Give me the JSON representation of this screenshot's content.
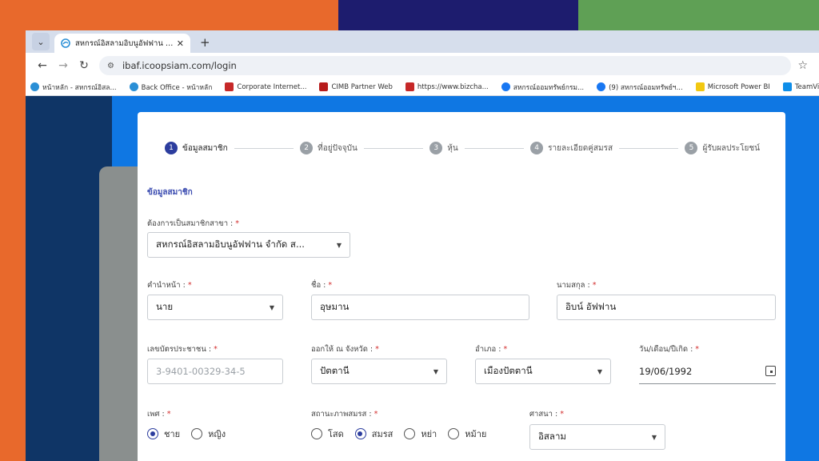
{
  "browser": {
    "tab_title": "สหกรณ์อิสลามอิบนูอัฟฟาน จำกัด",
    "url": "ibaf.icoopsiam.com/login",
    "bookmarks": [
      {
        "label": "หน้าหลัก - สหกรณ์อิสล...",
        "icon": "coop-logo",
        "color": "#2a8fd6"
      },
      {
        "label": "Back Office - หน้าหลัก",
        "icon": "coop-logo",
        "color": "#2a8fd6"
      },
      {
        "label": "Corporate Internet...",
        "icon": "bank-icon",
        "color": "#c62828"
      },
      {
        "label": "CIMB Partner Web",
        "icon": "cimb-icon",
        "color": "#b71c1c"
      },
      {
        "label": "https://www.bizcha...",
        "icon": "bank-icon",
        "color": "#c62828"
      },
      {
        "label": "สหกรณ์ออมทรัพย์กรม...",
        "icon": "facebook-icon",
        "color": "#1877f2"
      },
      {
        "label": "(9) สหกรณ์ออมทรัพย์ฯ...",
        "icon": "facebook-icon",
        "color": "#1877f2"
      },
      {
        "label": "Microsoft Power BI",
        "icon": "powerbi-icon",
        "color": "#f2c811"
      },
      {
        "label": "TeamViewer",
        "icon": "teamviewer-icon",
        "color": "#0e8ee9"
      }
    ]
  },
  "stepper": [
    {
      "num": "1",
      "label": "ข้อมูลสมาชิก",
      "active": true
    },
    {
      "num": "2",
      "label": "ที่อยู่ปัจจุบัน",
      "active": false
    },
    {
      "num": "3",
      "label": "หุ้น",
      "active": false
    },
    {
      "num": "4",
      "label": "รายละเอียดคู่สมรส",
      "active": false
    },
    {
      "num": "5",
      "label": "ผู้รับผลประโยชน์",
      "active": false
    }
  ],
  "form": {
    "section_title": "ข้อมูลสมาชิก",
    "branch": {
      "label": "ต้องการเป็นสมาชิกสาขา :",
      "value": "สหกรณ์อิสลามอิบนูอัฟฟาน จำกัด ส..."
    },
    "prefix": {
      "label": "คำนำหน้า :",
      "value": "นาย"
    },
    "first_name": {
      "label": "ชื่อ :",
      "value": "อุษมาน"
    },
    "last_name": {
      "label": "นามสกุล :",
      "value": "อิบน์ อัฟฟาน"
    },
    "id_card": {
      "label": "เลขบัตรประชาชน :",
      "value": "3-9401-00329-34-5"
    },
    "issue_province": {
      "label": "ออกให้ ณ จังหวัด :",
      "value": "ปัตตานี"
    },
    "district": {
      "label": "อำเภอ :",
      "value": "เมืองปัตตานี"
    },
    "birth_date": {
      "label": "วัน/เดือน/ปีเกิด :",
      "value": "19/06/1992"
    },
    "gender": {
      "label": "เพศ :",
      "options": [
        "ชาย",
        "หญิง"
      ],
      "selected": "ชาย"
    },
    "marital": {
      "label": "สถานะภาพสมรส :",
      "options": [
        "โสด",
        "สมรส",
        "หย่า",
        "หม้าย"
      ],
      "selected": "สมรส"
    },
    "religion": {
      "label": "ศาสนา :",
      "value": "อิสลาม"
    },
    "required_mark": "*"
  },
  "colors": {
    "accent": "#2c3d9e",
    "page_blue": "#0f77e3",
    "navy": "#0f3566"
  }
}
